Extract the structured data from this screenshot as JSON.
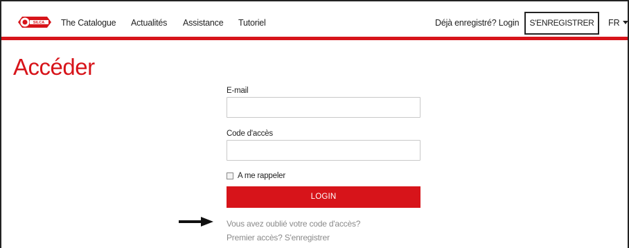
{
  "header": {
    "logo_text": "SILCA",
    "nav": [
      {
        "label": "The Catalogue"
      },
      {
        "label": "Actualités"
      },
      {
        "label": "Assistance"
      },
      {
        "label": "Tutoriel"
      }
    ],
    "login_link": "Déjà enregistré? Login",
    "register_label": "S'ENREGISTRER",
    "language": "FR"
  },
  "main": {
    "title": "Accéder",
    "email_label": "E-mail",
    "email_value": "",
    "password_label": "Code d'accès",
    "password_value": "",
    "remember_label": "A me rappeler",
    "login_button": "LOGIN",
    "forgot_link": "Vous avez oublié votre code d'accès?",
    "first_access_link": "Premier accès? S'enregistrer"
  },
  "colors": {
    "brand_red": "#d7141a",
    "link_gray": "#8a8a8a"
  },
  "icons": {
    "logo": "silca-key-logo",
    "language_caret": "caret-down-icon",
    "annotation": "arrow-right-icon"
  }
}
